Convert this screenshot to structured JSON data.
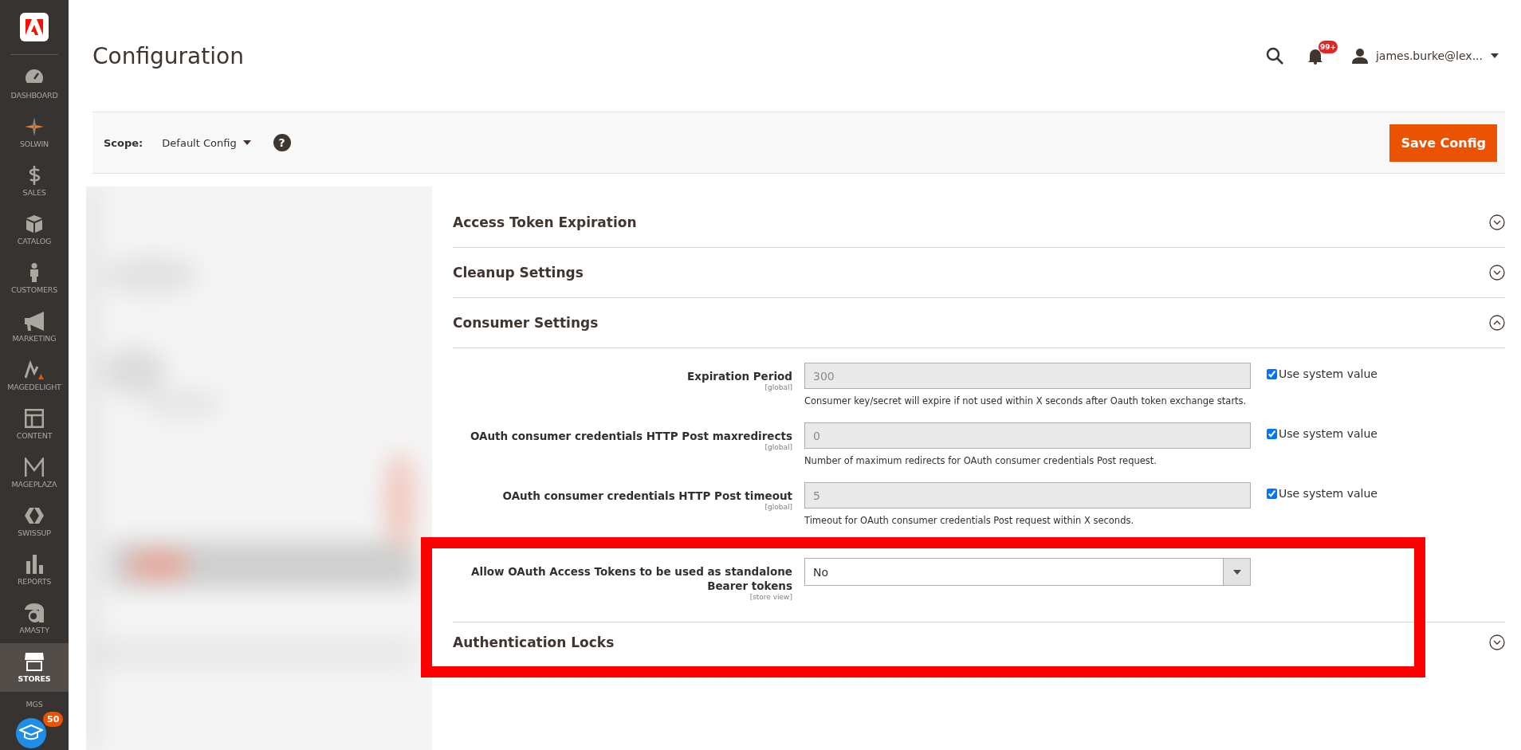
{
  "sidebar": {
    "items": [
      {
        "label": "DASHBOARD",
        "selected": false
      },
      {
        "label": "SOLWIN",
        "selected": false
      },
      {
        "label": "SALES",
        "selected": false
      },
      {
        "label": "CATALOG",
        "selected": false
      },
      {
        "label": "CUSTOMERS",
        "selected": false
      },
      {
        "label": "MARKETING",
        "selected": false
      },
      {
        "label": "MAGEDELIGHT",
        "selected": false
      },
      {
        "label": "CONTENT",
        "selected": false
      },
      {
        "label": "MAGEPLAZA",
        "selected": false
      },
      {
        "label": "SWISSUP",
        "selected": false
      },
      {
        "label": "REPORTS",
        "selected": false
      },
      {
        "label": "AMASTY",
        "selected": false
      },
      {
        "label": "STORES",
        "selected": true
      },
      {
        "label": "MGS",
        "selected": false
      }
    ],
    "help_badge": "50"
  },
  "page_title": "Configuration",
  "header": {
    "notifications": "99+",
    "user": "james.burke@lex..."
  },
  "scope": {
    "label": "Scope:",
    "value": "Default Config",
    "help": "?"
  },
  "save_button": "Save Config",
  "sections": [
    {
      "title": "Access Token Expiration",
      "expanded": false
    },
    {
      "title": "Cleanup Settings",
      "expanded": false
    },
    {
      "title": "Consumer Settings",
      "expanded": true,
      "fields": [
        {
          "kind": "text",
          "label": "Expiration Period",
          "scope": "[global]",
          "value": "300",
          "disabled": true,
          "use_system": "Use system value",
          "checked": true,
          "note": "Consumer key/secret will expire if not used within X seconds after Oauth token exchange starts."
        },
        {
          "kind": "text",
          "label": "OAuth consumer credentials HTTP Post maxredirects",
          "scope": "[global]",
          "value": "0",
          "disabled": true,
          "use_system": "Use system value",
          "checked": true,
          "note": "Number of maximum redirects for OAuth consumer credentials Post request."
        },
        {
          "kind": "text",
          "label": "OAuth consumer credentials HTTP Post timeout",
          "scope": "[global]",
          "value": "5",
          "disabled": true,
          "use_system": "Use system value",
          "checked": true,
          "note": "Timeout for OAuth consumer credentials Post request within X seconds."
        },
        {
          "kind": "select",
          "label": "Allow OAuth Access Tokens to be used as standalone Bearer tokens",
          "scope": "[store view]",
          "value": "No",
          "disabled": false
        }
      ]
    },
    {
      "title": "Authentication Locks",
      "expanded": false
    }
  ]
}
